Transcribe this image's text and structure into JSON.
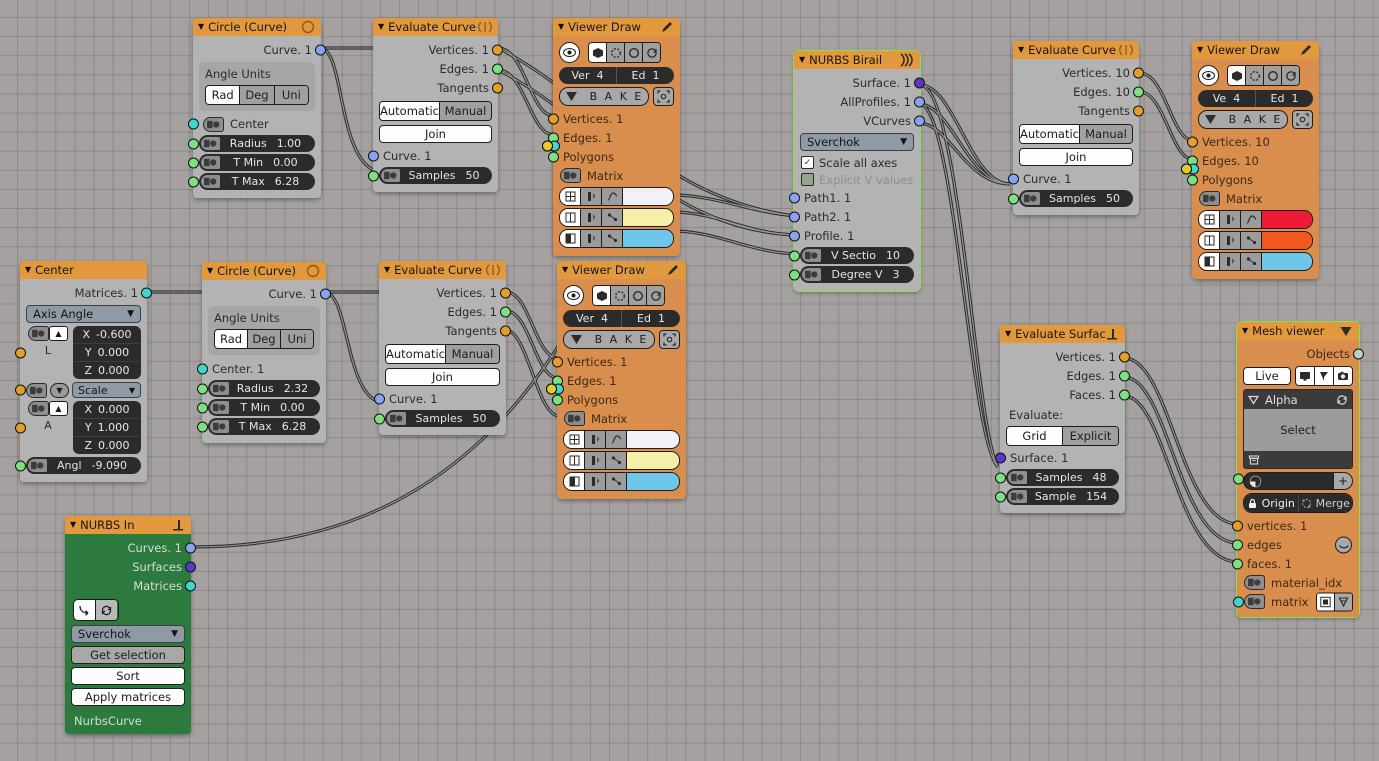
{
  "canvas": {
    "background": "#a5a1a1",
    "grid_color": "#8f8b8b",
    "grid_size": 19
  },
  "colors": {
    "header_orange": "#e2983c",
    "body_grey": "#b3b3b3",
    "body_orange": "#d98e4e",
    "body_green": "#2d7a3e",
    "selected_outline": "#89e14b",
    "socket_vertices": "#e2a02a",
    "socket_edges": "#7ee080",
    "socket_matrix": "#3fd6cf",
    "socket_curve": "#8aa2f2",
    "socket_surface": "#5b37c8",
    "swatch_white": "#f3f0f8",
    "swatch_yellow": "#f5efa8",
    "swatch_blue": "#6ec6e8",
    "swatch_red": "#ee1b38",
    "swatch_orange": "#f2571d"
  },
  "nodes": {
    "circle_top": {
      "title": "Circle (Curve)",
      "outputs": [
        {
          "label": "Curve. 1",
          "socket": "curve"
        }
      ],
      "angle_units": {
        "title": "Angle Units",
        "options": [
          "Rad",
          "Deg",
          "Uni"
        ],
        "selected": "Rad"
      },
      "fields": [
        {
          "label": "Center",
          "value": "",
          "socket": "matrix"
        },
        {
          "label": "Radius",
          "value": "1.00",
          "socket": "edges"
        },
        {
          "label": "T Min",
          "value": "0.00",
          "socket": "edges"
        },
        {
          "label": "T Max",
          "value": "6.28",
          "socket": "edges"
        }
      ]
    },
    "eval_curve_top": {
      "title": "Evaluate Curve",
      "outputs": [
        {
          "label": "Vertices. 1",
          "socket": "vertices"
        },
        {
          "label": "Edges. 1",
          "socket": "edges"
        },
        {
          "label": "Tangents",
          "socket": "vertices"
        }
      ],
      "mode": {
        "options": [
          "Automatic",
          "Manual"
        ],
        "selected": "Automatic"
      },
      "join_label": "Join",
      "input_label": "Curve. 1",
      "samples": {
        "label": "Samples",
        "value": "50"
      }
    },
    "viewer_draw_top": {
      "title": "Viewer Draw",
      "header_icon": "pencil-icon",
      "counts": [
        {
          "label": "Ver",
          "value": "4"
        },
        {
          "label": "Ed",
          "value": "1"
        }
      ],
      "bake_label": "B A K E",
      "inputs": [
        {
          "label": "Vertices. 1",
          "socket": "vertices"
        },
        {
          "label": "Edges. 1",
          "socket": "edges"
        },
        {
          "label": "Polygons",
          "socket": "edges"
        },
        {
          "label": "Matrix",
          "socket": "matrix"
        }
      ],
      "swatches": [
        "#f3f0f8",
        "#f5efa8",
        "#6ec6e8"
      ]
    },
    "nurbs_birail": {
      "title": "NURBS Birail",
      "header_icon": "birail-icon",
      "selected": true,
      "outputs": [
        {
          "label": "Surface. 1",
          "socket": "surface"
        },
        {
          "label": "AllProfiles. 1",
          "socket": "curve"
        },
        {
          "label": "VCurves",
          "socket": "curve"
        }
      ],
      "implementation": "Sverchok",
      "checkboxes": [
        {
          "label": "Scale all axes",
          "checked": true,
          "enabled": true
        },
        {
          "label": "Explicit V values",
          "checked": false,
          "enabled": false
        }
      ],
      "inputs": [
        {
          "label": "Path1. 1",
          "socket": "curve"
        },
        {
          "label": "Path2. 1",
          "socket": "curve"
        },
        {
          "label": "Profile. 1",
          "socket": "curve"
        }
      ],
      "fields": [
        {
          "label": "V Sectio",
          "value": "10",
          "socket": "edges"
        },
        {
          "label": "Degree V",
          "value": "3",
          "socket": "edges"
        }
      ]
    },
    "eval_curve_right": {
      "title": "Evaluate Curve",
      "outputs": [
        {
          "label": "Vertices. 10",
          "socket": "vertices"
        },
        {
          "label": "Edges. 10",
          "socket": "edges"
        },
        {
          "label": "Tangents",
          "socket": "vertices"
        }
      ],
      "mode": {
        "options": [
          "Automatic",
          "Manual"
        ],
        "selected": "Automatic"
      },
      "join_label": "Join",
      "input_label": "Curve. 1",
      "samples": {
        "label": "Samples",
        "value": "50"
      }
    },
    "viewer_draw_right": {
      "title": "Viewer Draw",
      "header_icon": "pencil-icon",
      "counts": [
        {
          "label": "Ve",
          "value": "4"
        },
        {
          "label": "Ed",
          "value": "1"
        }
      ],
      "bake_label": "B A K E",
      "inputs": [
        {
          "label": "Vertices. 10",
          "socket": "vertices"
        },
        {
          "label": "Edges. 10",
          "socket": "edges"
        },
        {
          "label": "Polygons",
          "socket": "edges"
        },
        {
          "label": "Matrix",
          "socket": "matrix"
        }
      ],
      "swatches": [
        "#ee1b38",
        "#f2571d",
        "#6ec6e8"
      ]
    },
    "center": {
      "title": "Center",
      "outputs": [
        {
          "label": "Matrices. 1",
          "socket": "matrix"
        }
      ],
      "mode": "Axis Angle",
      "location": {
        "group_label": "L",
        "values": [
          {
            "axis": "X",
            "value": "-0.600"
          },
          {
            "axis": "Y",
            "value": "0.000"
          },
          {
            "axis": "Z",
            "value": "0.000"
          }
        ]
      },
      "scale_dropdown": "Scale",
      "axis": {
        "group_label": "A",
        "values": [
          {
            "axis": "X",
            "value": "0.000"
          },
          {
            "axis": "Y",
            "value": "1.000"
          },
          {
            "axis": "Z",
            "value": "0.000"
          }
        ]
      },
      "angle": {
        "label": "Angl",
        "value": "-9.090"
      }
    },
    "circle_mid": {
      "title": "Circle (Curve)",
      "outputs": [
        {
          "label": "Curve. 1",
          "socket": "curve"
        }
      ],
      "angle_units": {
        "title": "Angle Units",
        "options": [
          "Rad",
          "Deg",
          "Uni"
        ],
        "selected": "Rad"
      },
      "center_label": "Center. 1",
      "fields": [
        {
          "label": "Radius",
          "value": "2.32",
          "socket": "edges"
        },
        {
          "label": "T Min",
          "value": "0.00",
          "socket": "edges"
        },
        {
          "label": "T Max",
          "value": "6.28",
          "socket": "edges"
        }
      ]
    },
    "eval_curve_mid": {
      "title": "Evaluate Curve",
      "outputs": [
        {
          "label": "Vertices. 1",
          "socket": "vertices"
        },
        {
          "label": "Edges. 1",
          "socket": "edges"
        },
        {
          "label": "Tangents",
          "socket": "vertices"
        }
      ],
      "mode": {
        "options": [
          "Automatic",
          "Manual"
        ],
        "selected": "Automatic"
      },
      "join_label": "Join",
      "input_label": "Curve. 1",
      "samples": {
        "label": "Samples",
        "value": "50"
      }
    },
    "viewer_draw_mid": {
      "title": "Viewer Draw",
      "header_icon": "pencil-icon",
      "counts": [
        {
          "label": "Ver",
          "value": "4"
        },
        {
          "label": "Ed",
          "value": "1"
        }
      ],
      "bake_label": "B A K E",
      "inputs": [
        {
          "label": "Vertices. 1",
          "socket": "vertices"
        },
        {
          "label": "Edges. 1",
          "socket": "edges"
        },
        {
          "label": "Polygons",
          "socket": "edges"
        },
        {
          "label": "Matrix",
          "socket": "matrix"
        }
      ],
      "swatches": [
        "#f3f0f8",
        "#f5efa8",
        "#6ec6e8"
      ]
    },
    "nurbs_in": {
      "title": "NURBS In",
      "header_icon": "blender-icon",
      "outputs": [
        {
          "label": "Curves. 1",
          "socket": "curve"
        },
        {
          "label": "Surfaces",
          "socket": "surface"
        },
        {
          "label": "Matrices",
          "socket": "matrix"
        }
      ],
      "implementation": "Sverchok",
      "buttons": [
        {
          "label": "Get selection",
          "style": "grey"
        },
        {
          "label": "Sort",
          "style": "white"
        },
        {
          "label": "Apply matrices",
          "style": "white"
        }
      ],
      "footer": "NurbsCurve"
    },
    "eval_surface": {
      "title": "Evaluate Surface",
      "header_icon": "blender-icon",
      "outputs": [
        {
          "label": "Vertices. 1",
          "socket": "vertices"
        },
        {
          "label": "Edges. 1",
          "socket": "edges"
        },
        {
          "label": "Faces. 1",
          "socket": "edges"
        }
      ],
      "evaluate_label": "Evaluate:",
      "mode": {
        "options": [
          "Grid",
          "Explicit"
        ],
        "selected": "Grid"
      },
      "input_label": "Surface. 1",
      "fields": [
        {
          "label": "Samples",
          "value": "48",
          "socket": "edges"
        },
        {
          "label": "Sample",
          "value": "154",
          "socket": "edges"
        }
      ]
    },
    "mesh_viewer": {
      "title": "Mesh viewer",
      "header_icon": "triangle-down-icon",
      "selected": true,
      "outputs": [
        {
          "label": "Objects",
          "socket": "object"
        }
      ],
      "live_label": "Live",
      "list": {
        "name": "Alpha",
        "select_label": "Select"
      },
      "origin_merge": [
        {
          "label": "Origin",
          "icon": "lock-icon"
        },
        {
          "label": "Merge",
          "icon": "merge-icon"
        }
      ],
      "inputs": [
        {
          "label": "vertices. 1",
          "socket": "vertices"
        },
        {
          "label": "edges",
          "socket": "edges"
        },
        {
          "label": "faces. 1",
          "socket": "edges"
        },
        {
          "label": "material_idx",
          "socket": "edges"
        },
        {
          "label": "matrix",
          "socket": "matrix"
        }
      ]
    }
  }
}
